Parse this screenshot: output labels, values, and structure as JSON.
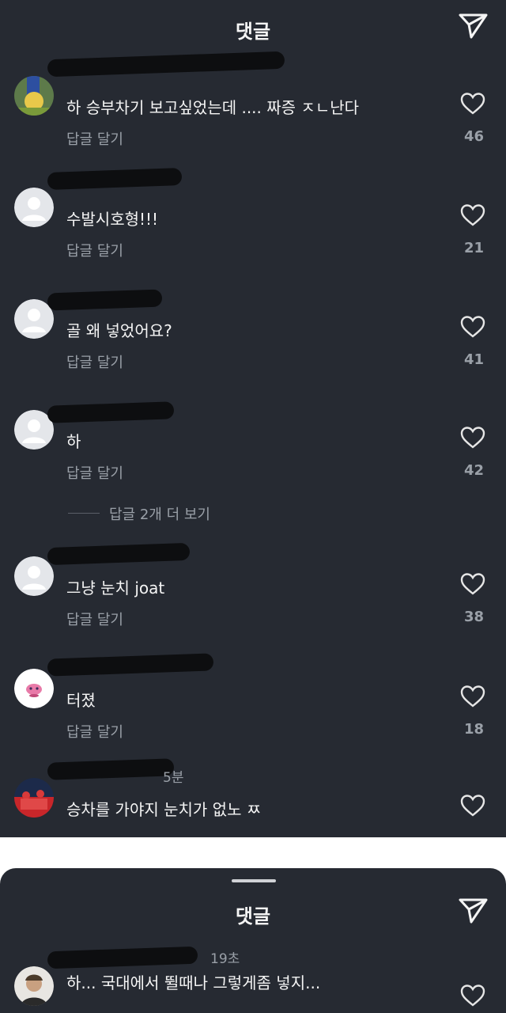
{
  "header": {
    "title": "댓글"
  },
  "comments": [
    {
      "text": "하 승부차기 보고싶었는데 .... 짜증 ㅈㄴ난다",
      "reply": "답글 달기",
      "likes": "46"
    },
    {
      "text": "수발시호형!!!",
      "reply": "답글 달기",
      "likes": "21"
    },
    {
      "text": "골 왜 넣었어요?",
      "reply": "답글 달기",
      "likes": "41"
    },
    {
      "text": "하",
      "reply": "답글 달기",
      "likes": "42"
    },
    {
      "text": "그냥 눈치 joat",
      "reply": "답글 달기",
      "likes": "38"
    },
    {
      "text": "터졌",
      "reply": "답글 달기",
      "likes": "18"
    },
    {
      "meta": "5분",
      "text": "승차를 가야지 눈치가 없노 ㅉ"
    }
  ],
  "view_more": "답글 2개 더 보기",
  "panel2": {
    "title": "댓글",
    "comment": {
      "meta": "19초",
      "text": "하... 국대에서 뛸때나 그렇게좀 넣지..."
    }
  }
}
